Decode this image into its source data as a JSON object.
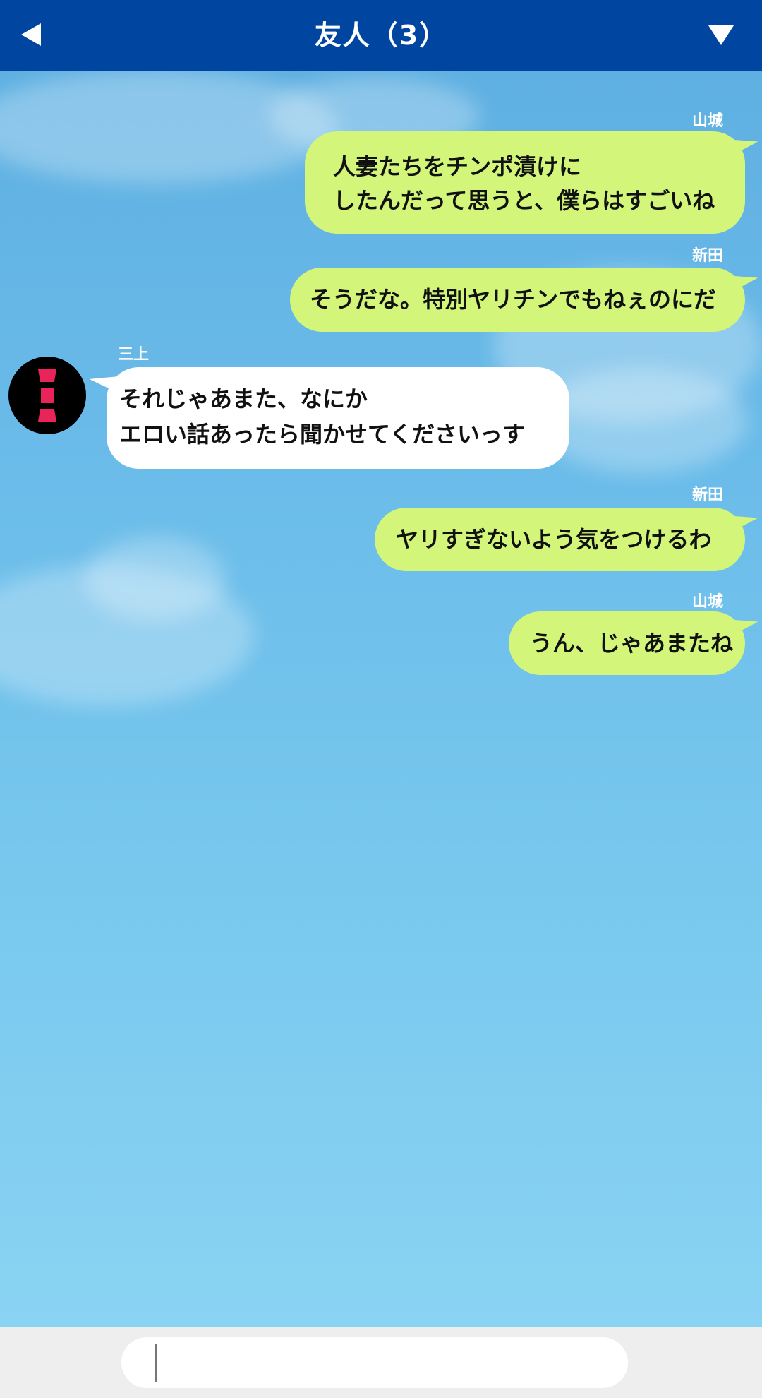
{
  "header": {
    "title": "友人（3）",
    "back_icon": "back-triangle-icon",
    "menu_icon": "dropdown-triangle-icon"
  },
  "messages": [
    {
      "sender": "山城",
      "side": "right",
      "lines": [
        "人妻たちをチンポ漬けに",
        "したんだって思うと、僕らはすごいね"
      ]
    },
    {
      "sender": "新田",
      "side": "right",
      "lines": [
        "そうだな。特別ヤリチンでもねぇのにだ"
      ]
    },
    {
      "sender": "三上",
      "side": "left",
      "lines": [
        "それじゃあまた、なにか",
        "エロい話あったら聞かせてくださいっす"
      ]
    },
    {
      "sender": "新田",
      "side": "right",
      "lines": [
        "ヤリすぎないよう気をつけるわ"
      ]
    },
    {
      "sender": "山城",
      "side": "right",
      "lines": [
        "うん、じゃあまたね"
      ]
    }
  ],
  "input": {
    "value": ""
  },
  "colors": {
    "header_bg": "#0046a0",
    "self_bubble": "#d3f57a",
    "other_bubble": "#ffffff",
    "avatar_accent": "#e8245a",
    "footer_bg": "#eeeeee"
  }
}
